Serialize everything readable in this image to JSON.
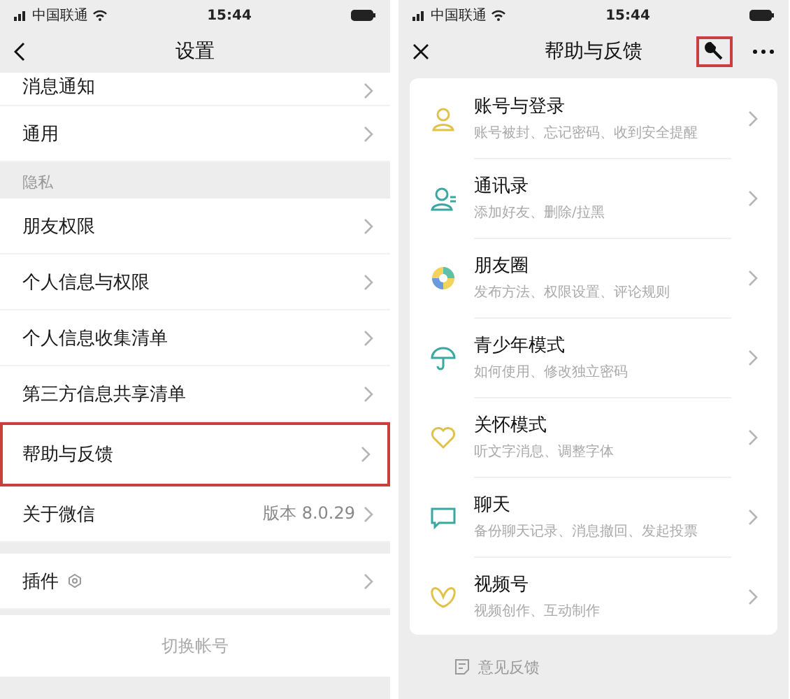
{
  "left": {
    "status_bar": {
      "carrier": "中国联通",
      "time": "15:44"
    },
    "title": "设置",
    "groups": [
      {
        "rows": [
          {
            "label": "消息通知",
            "highlighted": false
          },
          {
            "label": "通用",
            "highlighted": false
          }
        ]
      },
      {
        "header": "隐私",
        "rows": [
          {
            "label": "朋友权限",
            "highlighted": false
          },
          {
            "label": "个人信息与权限",
            "highlighted": false
          },
          {
            "label": "个人信息收集清单",
            "highlighted": false
          },
          {
            "label": "第三方信息共享清单",
            "highlighted": false
          },
          {
            "label": "帮助与反馈",
            "highlighted": true
          },
          {
            "label": "关于微信",
            "value": "版本 8.0.29",
            "highlighted": false
          }
        ]
      },
      {
        "rows": [
          {
            "label": "插件",
            "badge": true,
            "highlighted": false
          }
        ]
      }
    ],
    "footer": "切换帐号"
  },
  "right": {
    "status_bar": {
      "carrier": "中国联通",
      "time": "15:44"
    },
    "title": "帮助与反馈",
    "tool_highlighted": true,
    "items": [
      {
        "kind": "account",
        "title": "账号与登录",
        "subtitle": "账号被封、忘记密码、收到安全提醒"
      },
      {
        "kind": "contacts",
        "title": "通讯录",
        "subtitle": "添加好友、删除/拉黑"
      },
      {
        "kind": "moments",
        "title": "朋友圈",
        "subtitle": "发布方法、权限设置、评论规则"
      },
      {
        "kind": "teen",
        "title": "青少年模式",
        "subtitle": "如何使用、修改独立密码"
      },
      {
        "kind": "care",
        "title": "关怀模式",
        "subtitle": "听文字消息、调整字体"
      },
      {
        "kind": "chat",
        "title": "聊天",
        "subtitle": "备份聊天记录、消息撤回、发起投票"
      },
      {
        "kind": "channels",
        "title": "视频号",
        "subtitle": "视频创作、互动制作"
      }
    ],
    "footer": "意见反馈"
  }
}
